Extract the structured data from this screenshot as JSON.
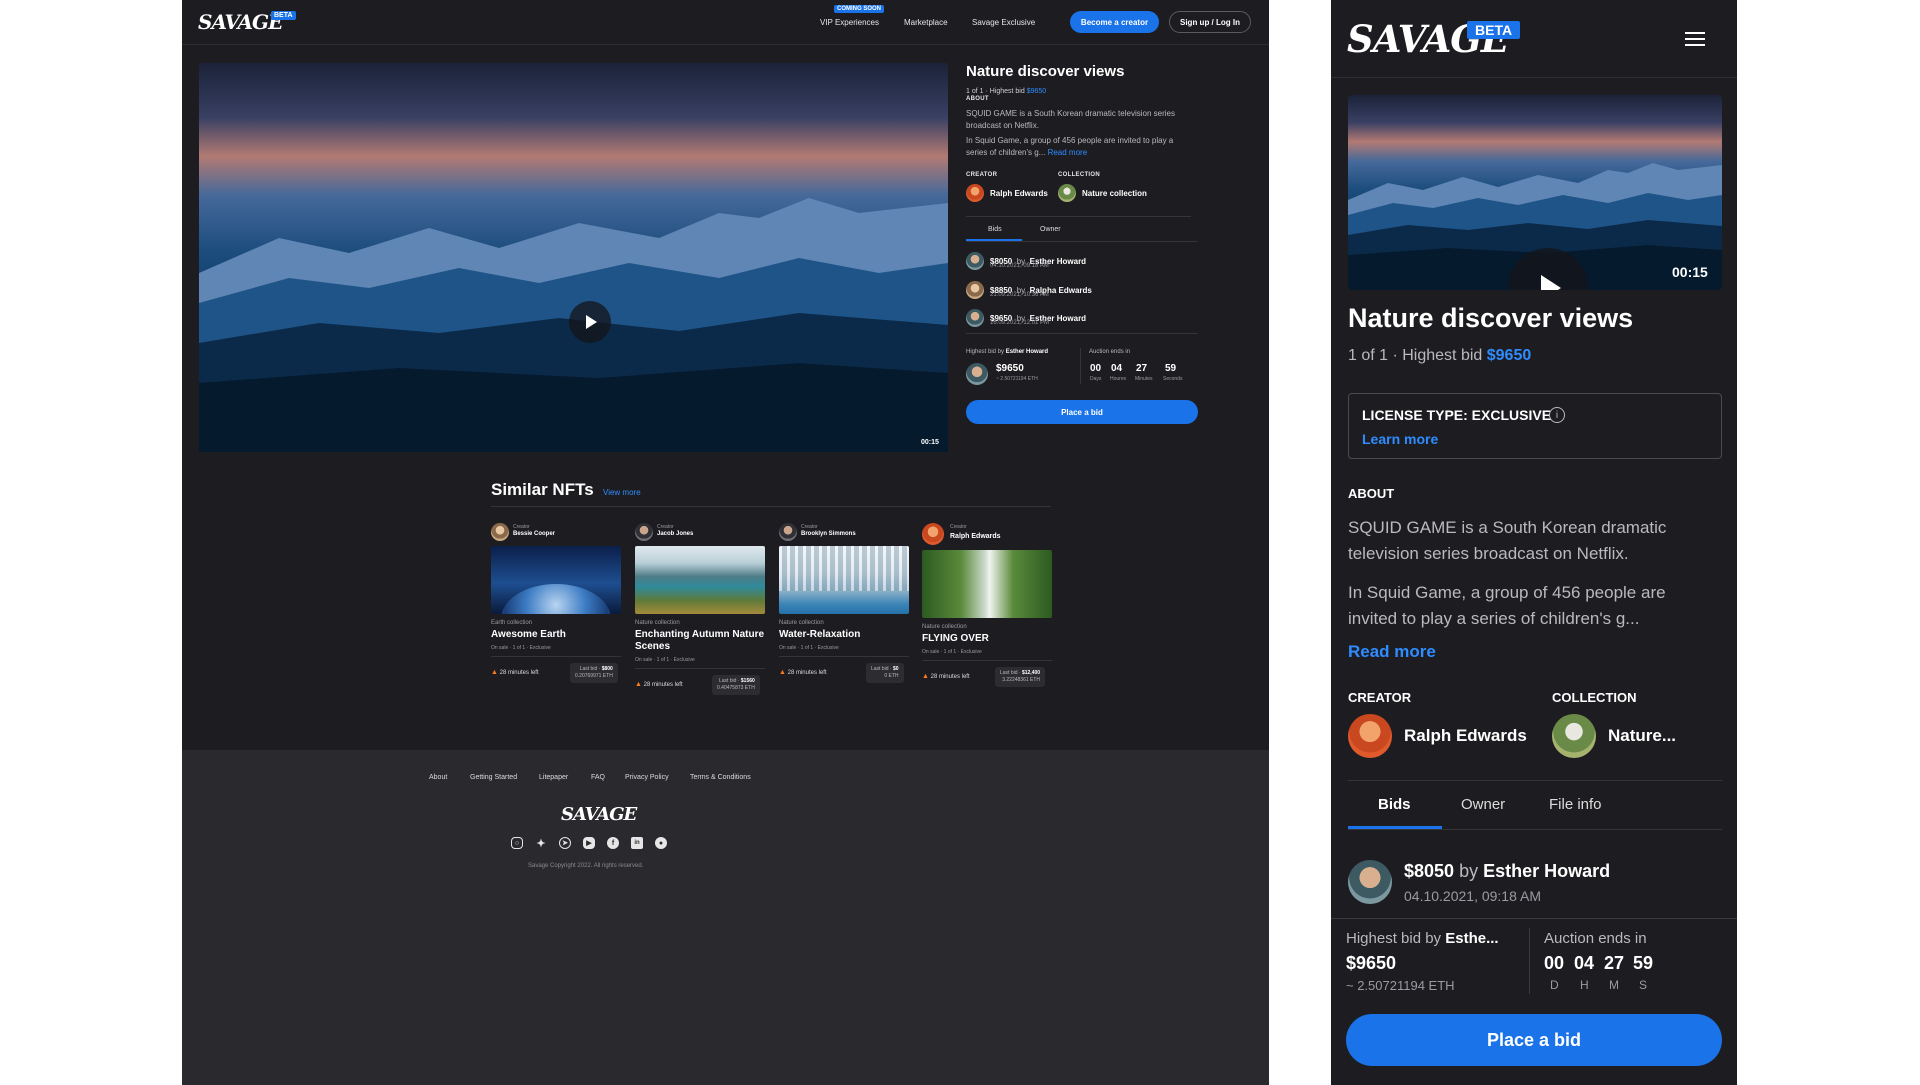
{
  "desktop": {
    "header": {
      "logo": "SAVAGE",
      "beta": "BETA",
      "coming_soon": "COMING SOON",
      "nav": [
        "VIP Experiences",
        "Marketplace",
        "Savage Exclusive"
      ],
      "become_creator": "Become a creator",
      "signup": "Sign up / Log In"
    },
    "media": {
      "duration": "00:15"
    },
    "detail": {
      "title": "Nature discover views",
      "edition": "1 of 1 · Highest bid",
      "highest_bid": "$9650",
      "about_label": "ABOUT",
      "about_p1": "SQUID GAME is a South Korean dramatic television series broadcast on Netflix.",
      "about_p2": "In Squid Game, a group of 456 people  are invited to play a series of children's g...",
      "read_more": "Read more",
      "creator_label": "CREATOR",
      "creator_name": "Ralph Edwards",
      "collection_label": "COLLECTION",
      "collection_name": "Nature collection",
      "tabs": [
        "Bids",
        "Owner"
      ],
      "bids": [
        {
          "amount": "$8050",
          "by": "by",
          "name": "Esther Howard",
          "date": "04.10.2021, 09:18 AM"
        },
        {
          "amount": "$8850",
          "by": "by",
          "name": "Ralpha Edwards",
          "date": "21.09.2021, 10:36 AM"
        },
        {
          "amount": "$9650",
          "by": "by",
          "name": "Esther Howard",
          "date": "16.09.2021, 12:01 PM"
        }
      ],
      "highest_by_label": "Highest bid by",
      "highest_by_name": "Esther Howard",
      "highest_amount": "$9650",
      "highest_eth": "~ 2.50721194 ETH",
      "auction_label": "Auction ends in",
      "countdown": [
        {
          "value": "00",
          "label": "Days"
        },
        {
          "value": "04",
          "label": "Houres"
        },
        {
          "value": "27",
          "label": "Minutes"
        },
        {
          "value": "59",
          "label": "Seconds"
        }
      ],
      "place_bid": "Place a bid"
    },
    "similar": {
      "title": "Similar NFTs",
      "view_more": "View more",
      "creator_caption": "Creator",
      "cards": [
        {
          "creator": "Bessie Cooper",
          "collection": "Earth collection",
          "title": "Awesome Earth",
          "meta": "On sale · 1 of 1 · Exclusive",
          "time": "28 minutes left",
          "last_bid_label": "Last bid ·",
          "last_bid": "$800",
          "eth": "0.20769971 ETH"
        },
        {
          "creator": "Jacob Jones",
          "collection": "Nature collection",
          "title": "Enchanting Autumn Nature Scenes",
          "meta": "On sale · 1 of 1 · Exclusive",
          "time": "28 minutes left",
          "last_bid_label": "Last bid ·",
          "last_bid": "$1560",
          "eth": "0.40475873 ETH"
        },
        {
          "creator": "Brooklyn Simmons",
          "collection": "Nature collection",
          "title": "Water-Relaxation",
          "meta": "On sale · 1 of 1 · Exclusive",
          "time": "28 minutes left",
          "last_bid_label": "Last bid ·",
          "last_bid": "$0",
          "eth": "0 ETH"
        },
        {
          "creator": "Ralph Edwards",
          "collection": "Nature collection",
          "title": "FLYING OVER",
          "meta": "On sale · 1 of 1 · Exclusive",
          "time": "28 minutes left",
          "last_bid_label": "Last bid ·",
          "last_bid": "$12,400",
          "eth": "3.22248361 ETH"
        }
      ]
    },
    "footer": {
      "links": [
        "About",
        "Getting Started",
        "Litepaper",
        "FAQ",
        "Privacy Policy",
        "Terms & Conditions"
      ],
      "logo": "SAVAGE",
      "social_icons": [
        "instagram-icon",
        "twitter-icon",
        "telegram-icon",
        "youtube-icon",
        "facebook-icon",
        "linkedin-icon",
        "discord-icon"
      ],
      "copyright": "Savage Copyright 2022. All rights reserved."
    }
  },
  "mobile": {
    "logo": "SAVAGE",
    "beta": "BETA",
    "duration": "00:15",
    "title": "Nature discover views",
    "edition": "1 of 1 · Highest bid",
    "highest_bid": "$9650",
    "license_title": "LICENSE TYPE: EXCLUSIVE",
    "learn_more": "Learn more",
    "about_label": "ABOUT",
    "about_p1": "SQUID GAME is a South Korean dramatic television series broadcast on Netflix.",
    "about_p2": "In Squid Game, a group of 456 people  are invited to play a series of children's g...",
    "read_more": "Read more",
    "creator_label": "CREATOR",
    "creator_name": "Ralph Edwards",
    "collection_label": "COLLECTION",
    "collection_name": "Nature...",
    "tabs": [
      "Bids",
      "Owner",
      "File info"
    ],
    "bid": {
      "amount": "$8050",
      "by": "by",
      "name": "Esther Howard",
      "date": "04.10.2021,  09:18 AM"
    },
    "highest_by_label": "Highest bid by",
    "highest_by_name": "Esthe...",
    "highest_amount": "$9650",
    "highest_eth": "~ 2.50721194 ETH",
    "auction_label": "Auction ends in",
    "countdown": [
      {
        "value": "00",
        "label": "D"
      },
      {
        "value": "04",
        "label": "H"
      },
      {
        "value": "27",
        "label": "M"
      },
      {
        "value": "59",
        "label": "S"
      }
    ],
    "place_bid": "Place a bid"
  },
  "colors": {
    "accent": "#1a73e8",
    "link": "#2f8cff",
    "background": "#1d1d21",
    "footer": "#2a2a2e"
  }
}
